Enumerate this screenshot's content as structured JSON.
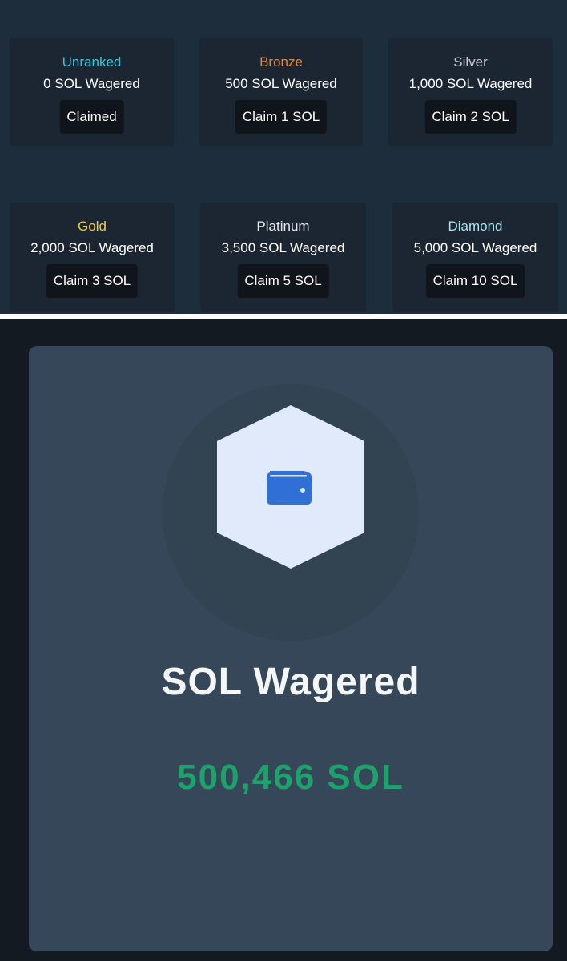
{
  "tiers": [
    {
      "name": "Unranked",
      "wager": "0 SOL Wagered",
      "action": "Claimed",
      "color": "#2ec8dd"
    },
    {
      "name": "Bronze",
      "wager": "500 SOL Wagered",
      "action": "Claim 1 SOL",
      "color": "#d98b4a"
    },
    {
      "name": "Silver",
      "wager": "1,000 SOL Wagered",
      "action": "Claim 2 SOL",
      "color": "#c5cad0"
    },
    {
      "name": "Gold",
      "wager": "2,000 SOL Wagered",
      "action": "Claim 3 SOL",
      "color": "#f1cd37"
    },
    {
      "name": "Platinum",
      "wager": "3,500 SOL Wagered",
      "action": "Claim 5 SOL",
      "color": "#e6eaee"
    },
    {
      "name": "Diamond",
      "wager": "5,000 SOL Wagered",
      "action": "Claim 10 SOL",
      "color": "#a7e6f2"
    }
  ],
  "stat": {
    "icon": "wallet-icon",
    "label": "SOL Wagered",
    "value": "500,466 SOL"
  },
  "colors": {
    "accent_green": "#1ea26b",
    "wallet_blue": "#2f6fd6"
  }
}
